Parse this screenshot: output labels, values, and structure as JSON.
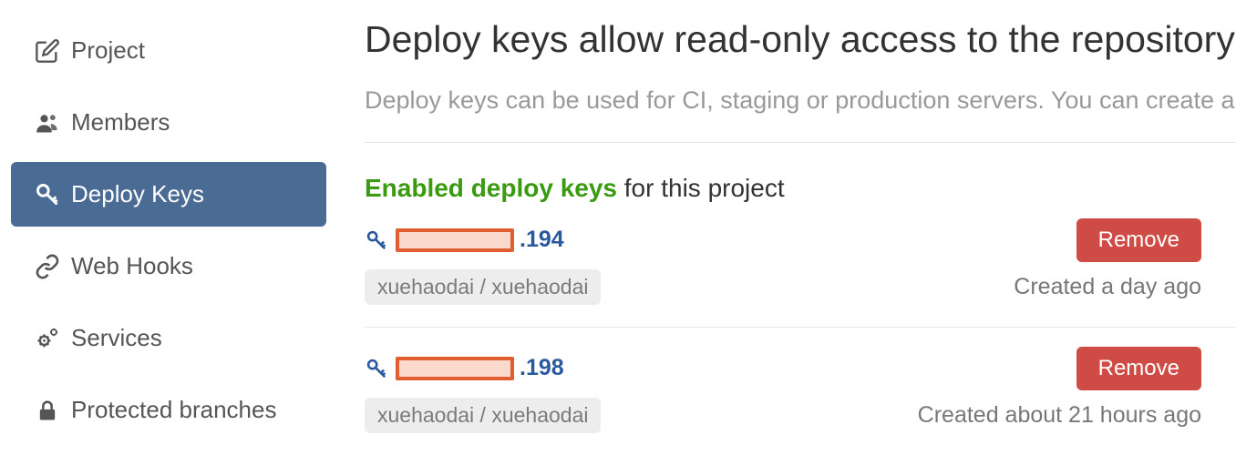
{
  "sidebar": {
    "items": [
      {
        "label": "Project"
      },
      {
        "label": "Members"
      },
      {
        "label": "Deploy Keys"
      },
      {
        "label": "Web Hooks"
      },
      {
        "label": "Services"
      },
      {
        "label": "Protected branches"
      }
    ]
  },
  "main": {
    "title": "Deploy keys allow read-only access to the repository",
    "subtitle": "Deploy keys can be used for CI, staging or production servers. You can create a deploy key",
    "section_highlight": "Enabled deploy keys",
    "section_rest": " for this project",
    "keys": [
      {
        "suffix": ".194",
        "tag": "xuehaodai / xuehaodai",
        "created": "Created a day ago",
        "remove": "Remove"
      },
      {
        "suffix": ".198",
        "tag": "xuehaodai / xuehaodai",
        "created": "Created about 21 hours ago",
        "remove": "Remove"
      }
    ]
  }
}
